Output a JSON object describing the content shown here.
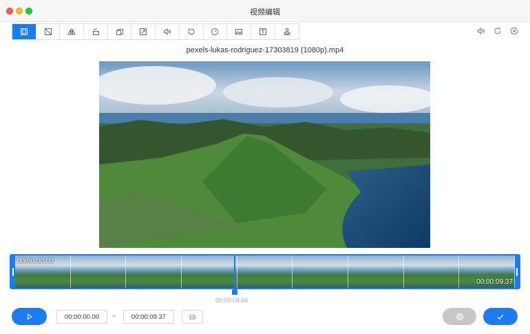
{
  "window": {
    "title": "视频编辑"
  },
  "toolbar": {
    "tools": [
      {
        "icon": "crop-frame-icon",
        "active": true
      },
      {
        "icon": "crop-icon"
      },
      {
        "icon": "flip-icon"
      },
      {
        "icon": "rotate-icon"
      },
      {
        "icon": "layers-icon"
      },
      {
        "icon": "resize-icon"
      },
      {
        "icon": "volume-icon"
      },
      {
        "icon": "loop-icon"
      },
      {
        "icon": "speed-icon"
      },
      {
        "icon": "image-icon"
      },
      {
        "icon": "text-icon"
      },
      {
        "icon": "watermark-icon"
      }
    ],
    "right_tools": [
      "volume-icon",
      "refresh-icon",
      "close-circle-icon"
    ]
  },
  "file": {
    "name": "pexels-lukas-rodriguez-17303819 (1080p).mp4"
  },
  "timeline": {
    "start_label": "00:00:00.00",
    "end_label": "00:00:09.37",
    "playhead_time": "00:00:04.66",
    "frame_count": 9
  },
  "controls": {
    "start_time": "00:00:00.00",
    "separator": "-",
    "end_time": "00:00:09.37"
  }
}
